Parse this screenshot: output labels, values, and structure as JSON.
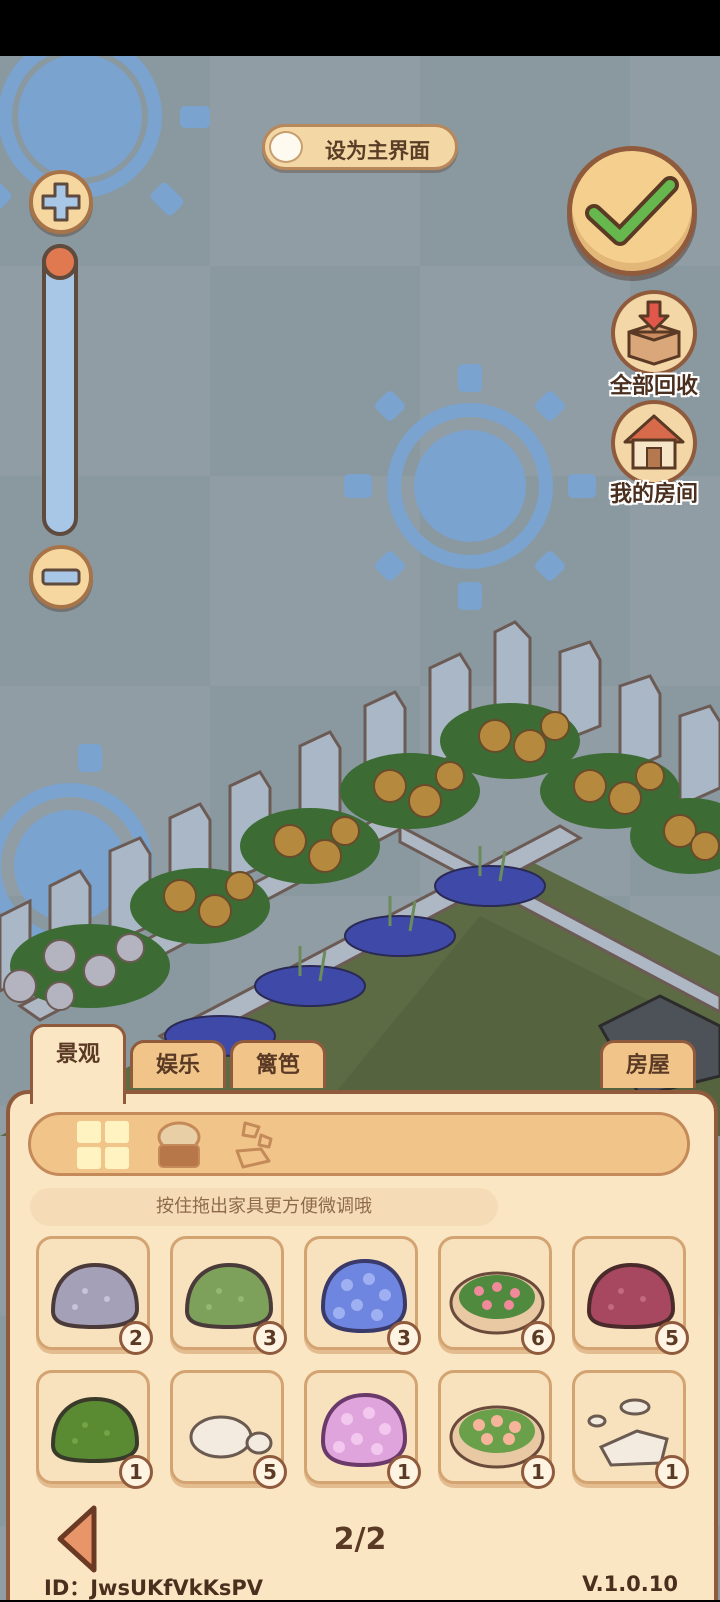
{
  "toggle": {
    "label": "设为主界面",
    "on": false
  },
  "side_buttons": {
    "recycle_all": "全部回收",
    "my_room": "我的房间"
  },
  "zoom": {
    "level": 0.0
  },
  "tabs": [
    {
      "label": "景观",
      "active": true
    },
    {
      "label": "娱乐",
      "active": false
    },
    {
      "label": "篱笆",
      "active": false
    },
    {
      "label": "房屋",
      "active": false
    }
  ],
  "category_icons": [
    "grid-icon",
    "plant-pot-icon",
    "stones-icon"
  ],
  "hint": "按住拖出家具更方便微调哦",
  "items": [
    {
      "name": "gray-bush",
      "count": "2"
    },
    {
      "name": "green-bush",
      "count": "3"
    },
    {
      "name": "blue-hydrangea",
      "count": "3"
    },
    {
      "name": "pink-flower-bed",
      "count": "6"
    },
    {
      "name": "red-bush",
      "count": "5"
    },
    {
      "name": "dark-green-bush",
      "count": "1"
    },
    {
      "name": "white-stones",
      "count": "5"
    },
    {
      "name": "pink-hydrangea",
      "count": "1"
    },
    {
      "name": "peach-flower-bed",
      "count": "1"
    },
    {
      "name": "stepping-stones",
      "count": "1"
    }
  ],
  "pagination": {
    "text": "2/2"
  },
  "footer": {
    "id": "ID：JwsUKfVkKsPV",
    "version": "V.1.0.10"
  }
}
